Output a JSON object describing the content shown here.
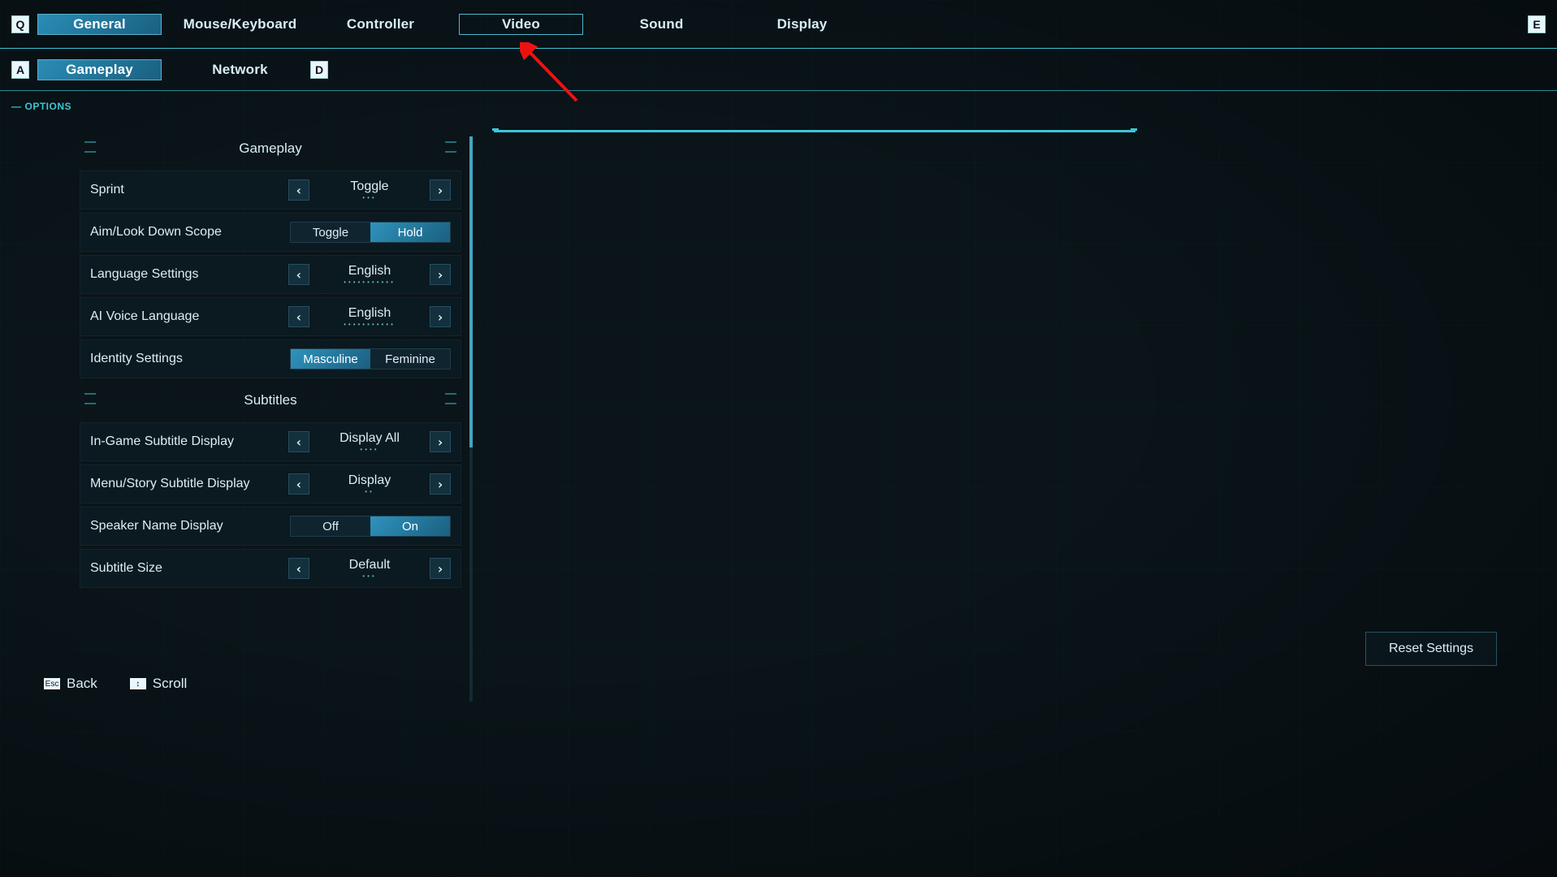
{
  "tabs": {
    "q_key": "Q",
    "e_key": "E",
    "row1": [
      "General",
      "Mouse/Keyboard",
      "Controller",
      "Video",
      "Sound",
      "Display"
    ],
    "row1_active": 0,
    "row1_outlined": 3,
    "a_key": "A",
    "d_key": "D",
    "row2": [
      "Gameplay",
      "Network"
    ],
    "row2_active": 0
  },
  "options_label": "OPTIONS",
  "sections": [
    {
      "title": "Gameplay",
      "rows": [
        {
          "label": "Sprint",
          "type": "carousel",
          "value": "Toggle",
          "dots": 3
        },
        {
          "label": "Aim/Look Down Scope",
          "type": "segment",
          "options": [
            "Toggle",
            "Hold"
          ],
          "selected": 1
        },
        {
          "label": "Language Settings",
          "type": "carousel",
          "value": "English",
          "dots": 11
        },
        {
          "label": "AI Voice Language",
          "type": "carousel",
          "value": "English",
          "dots": 11
        },
        {
          "label": "Identity Settings",
          "type": "segment",
          "options": [
            "Masculine",
            "Feminine"
          ],
          "selected": 0
        }
      ]
    },
    {
      "title": "Subtitles",
      "rows": [
        {
          "label": "In-Game Subtitle Display",
          "type": "carousel",
          "value": "Display All",
          "dots": 4
        },
        {
          "label": "Menu/Story Subtitle Display",
          "type": "carousel",
          "value": "Display",
          "dots": 2
        },
        {
          "label": "Speaker Name Display",
          "type": "segment",
          "options": [
            "Off",
            "On"
          ],
          "selected": 1
        },
        {
          "label": "Subtitle Size",
          "type": "carousel",
          "value": "Default",
          "dots": 3
        }
      ]
    }
  ],
  "reset": "Reset Settings",
  "footer": {
    "back": "Back",
    "scroll": "Scroll",
    "back_key": "Esc",
    "scroll_key": "↕"
  },
  "colors": {
    "accent": "#3cc6d8",
    "accent_fill": "#2a8db6"
  }
}
